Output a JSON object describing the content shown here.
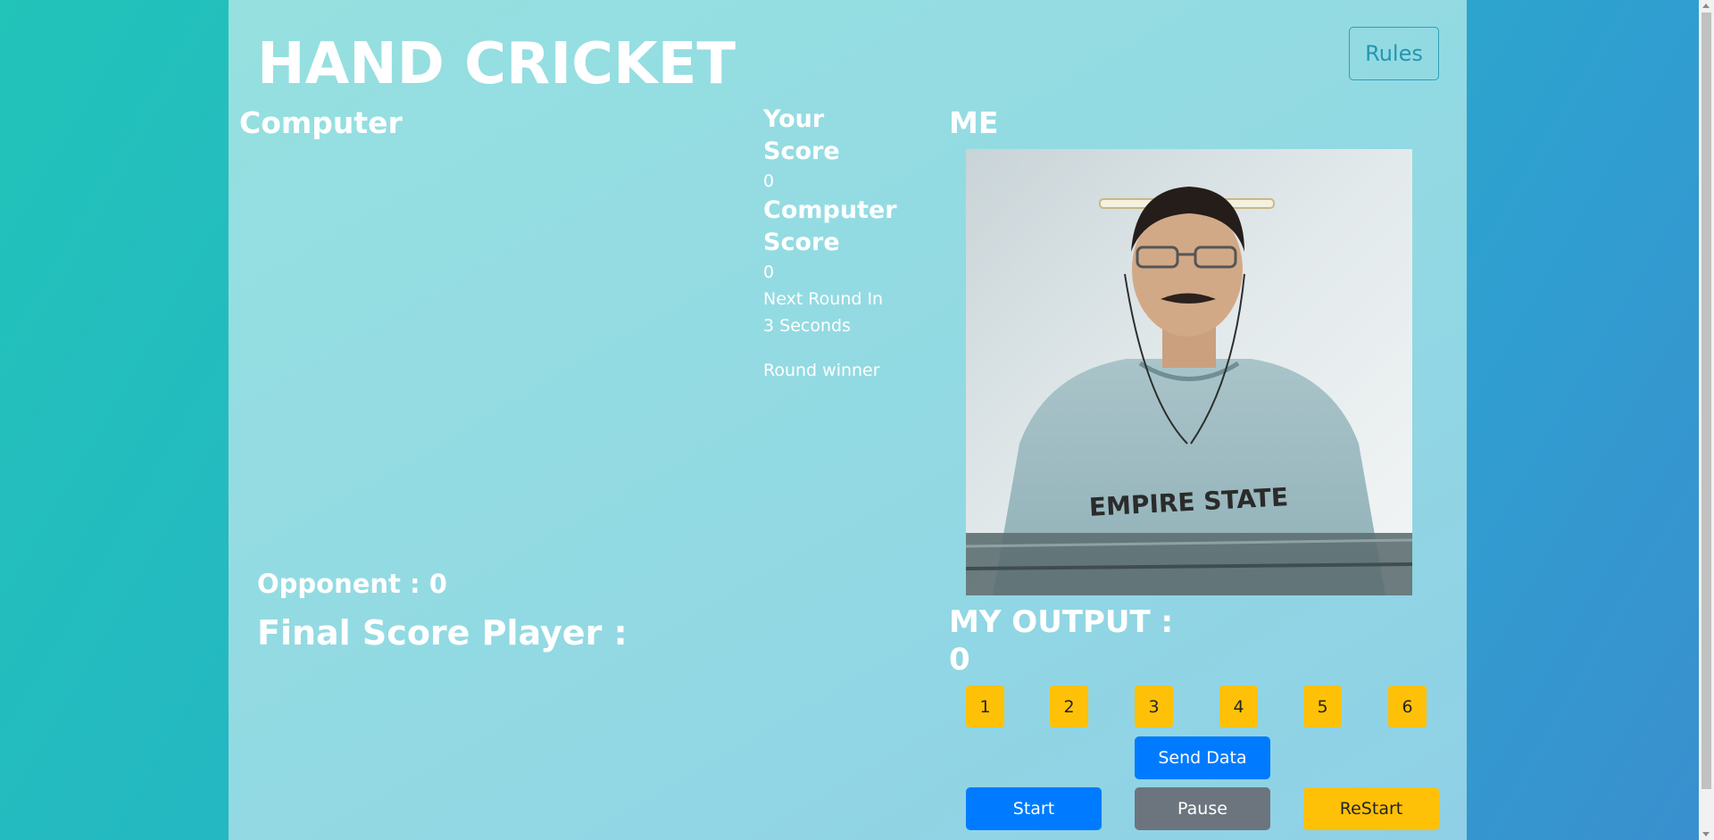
{
  "header": {
    "title": "HAND CRICKET",
    "rules_label": "Rules"
  },
  "computer_section": {
    "heading": "Computer",
    "opponent_label": "Opponent : 0",
    "final_score_label": "Final Score Player :"
  },
  "scoreboard": {
    "your_score_label": "Your Score",
    "your_score_value": "0",
    "computer_score_label": "Computer Score",
    "computer_score_value": "0",
    "next_round_text": "Next Round In 3 Seconds",
    "round_winner_text": "Round winner"
  },
  "me_section": {
    "heading": "ME",
    "shirt_text": "EMPIRE STATE",
    "output_label": "MY OUTPUT :",
    "output_value": "0"
  },
  "number_buttons": [
    "1",
    "2",
    "3",
    "4",
    "5",
    "6"
  ],
  "controls": {
    "send_data_label": "Send Data",
    "start_label": "Start",
    "pause_label": "Pause",
    "restart_label": "ReStart"
  },
  "colors": {
    "primary_blue": "#007bff",
    "warning_yellow": "#ffc107",
    "secondary_gray": "#6c757d"
  }
}
